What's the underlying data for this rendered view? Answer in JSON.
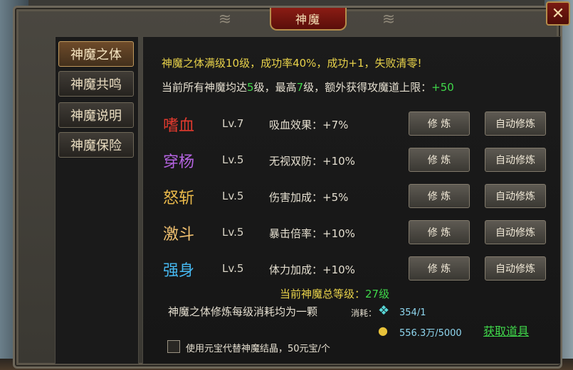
{
  "window": {
    "title": "神魔",
    "close_label": "✕"
  },
  "sidebar": {
    "tabs": [
      {
        "label": "神魔之体",
        "active": true
      },
      {
        "label": "神魔共鸣",
        "active": false
      },
      {
        "label": "神魔说明",
        "active": false
      },
      {
        "label": "神魔保险",
        "active": false
      }
    ]
  },
  "info": {
    "line1": "神魔之体满级10级，成功率40%，成功+1，失败清零!",
    "line2_a": "当前所有神魔均达",
    "line2_min": "5",
    "line2_b": "级，最高",
    "line2_max": "7",
    "line2_c": "级，额外获得攻魔道上限：",
    "line2_bonus": "+50"
  },
  "skills": [
    {
      "name": "嗜血",
      "color": "#e23a2e",
      "level": "Lv.7",
      "effect": "吸血效果：+7%",
      "train": "修 炼",
      "auto": "自动修炼"
    },
    {
      "name": "穿杨",
      "color": "#b463e0",
      "level": "Lv.5",
      "effect": "无视双防：+10%",
      "train": "修 炼",
      "auto": "自动修炼"
    },
    {
      "name": "怒斩",
      "color": "#e8b84a",
      "level": "Lv.5",
      "effect": "伤害加成：+5%",
      "train": "修 炼",
      "auto": "自动修炼"
    },
    {
      "name": "激斗",
      "color": "#f0c070",
      "level": "Lv.5",
      "effect": "暴击倍率：+10%",
      "train": "修 炼",
      "auto": "自动修炼"
    },
    {
      "name": "强身",
      "color": "#46b8f0",
      "level": "Lv.5",
      "effect": "体力加成：+10%",
      "train": "修 炼",
      "auto": "自动修炼"
    }
  ],
  "summary": {
    "total_label": "当前神魔总等级：",
    "total_value": "27级",
    "cost_text": "神魔之体修炼每级消耗均为一颗",
    "cost_label": "消耗：",
    "crystal_value": "354/1",
    "gold_value": "556.3万/5000",
    "get_items": "获取道具",
    "checkbox_label": "使用元宝代替神魔结晶，50元宝/个"
  }
}
